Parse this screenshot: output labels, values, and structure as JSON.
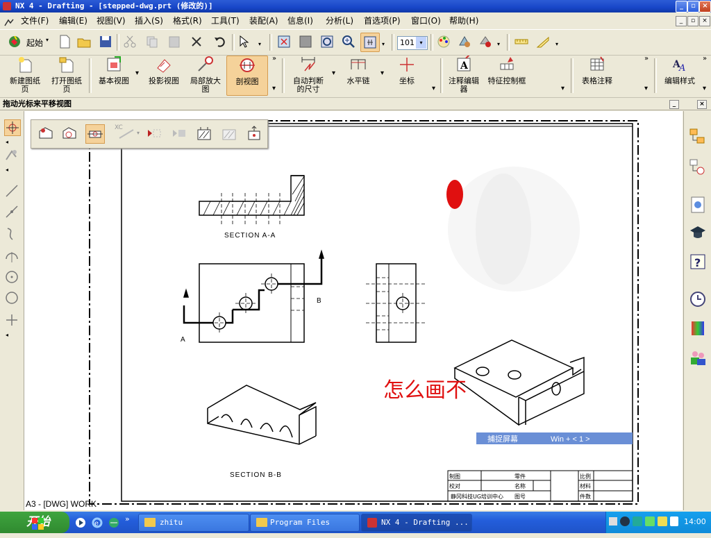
{
  "window": {
    "title": "NX 4 - Drafting - [stepped-dwg.prt (修改的)]"
  },
  "menu": [
    "文件(F)",
    "编辑(E)",
    "视图(V)",
    "插入(S)",
    "格式(R)",
    "工具(T)",
    "装配(A)",
    "信息(I)",
    "分析(L)",
    "首选项(P)",
    "窗口(O)",
    "帮助(H)"
  ],
  "toolbar1": {
    "start_label": "起始",
    "zoom_value": "101"
  },
  "toolbar2": {
    "buttons": [
      "新建图纸页",
      "打开图纸页",
      "基本视图",
      "投影视图",
      "局部放大图",
      "剖视图",
      "自动判断的尺寸",
      "水平链",
      "坐标",
      "注释编辑器",
      "特征控制框",
      "表格注释",
      "编辑样式"
    ]
  },
  "status": "拖动光标来平移视图",
  "floating_toolbar": {
    "xc_label": "XC"
  },
  "drawing": {
    "section_aa": "SECTION A-A",
    "section_bb": "SECTION B-B",
    "marker_a": "A",
    "marker_b": "B",
    "annotation": "怎么画不",
    "capture_label": "捕捉屏幕",
    "capture_shortcut": "Win + < 1 >",
    "title_block": {
      "drawn": "制图",
      "checked": "校对",
      "part": "零件",
      "name": "名称",
      "scale": "比例",
      "material": "材料",
      "drawing_no": "图号",
      "pieces": "件数",
      "company": "静冈科技UG培训中心"
    },
    "work_label": "A3 - [DWG] WORK"
  },
  "taskbar": {
    "start": "开始",
    "tasks": [
      "zhitu",
      "Program Files",
      "NX 4 - Drafting ..."
    ],
    "clock": "14:00"
  },
  "colors": {
    "accent": "#F5D29A",
    "titlebar": "#1846C8",
    "capture_bar": "#6A8FD6",
    "annotation_red": "#E01010"
  }
}
